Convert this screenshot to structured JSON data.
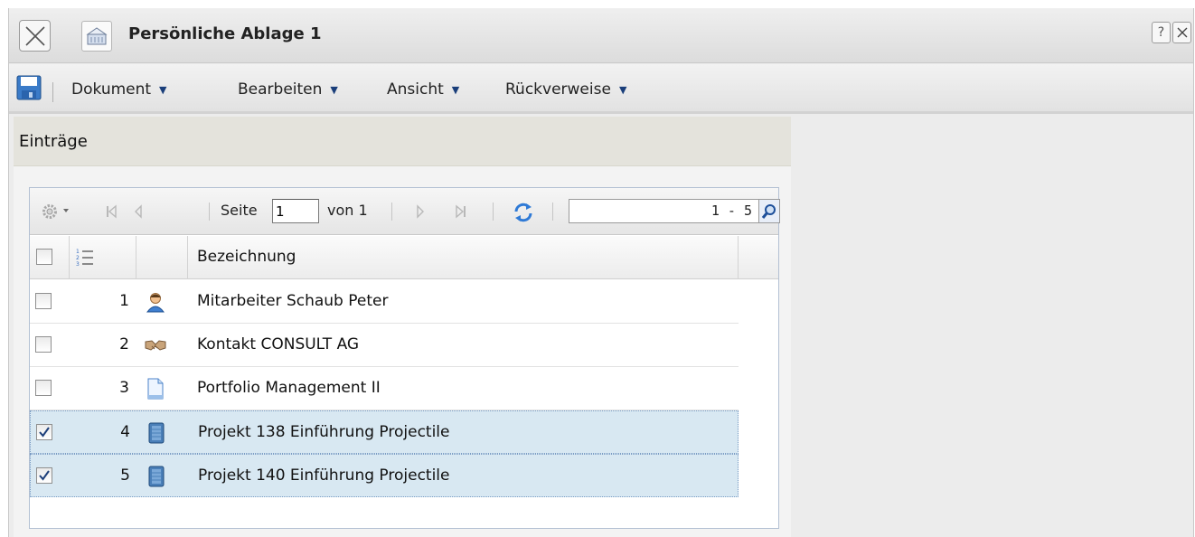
{
  "window": {
    "title": "Persönliche Ablage 1",
    "help_label": "?"
  },
  "menu": {
    "items": [
      {
        "label": "Dokument"
      },
      {
        "label": "Bearbeiten"
      },
      {
        "label": "Ansicht"
      },
      {
        "label": "Rückverweise"
      }
    ],
    "caret": "▼"
  },
  "panel": {
    "title": "Einträge"
  },
  "pager": {
    "page_label": "Seite",
    "page_value": "1",
    "of_label": "von 1",
    "range": "1 - 5"
  },
  "table": {
    "column_header": "Bezeichnung",
    "rows": [
      {
        "num": "1",
        "label": "Mitarbeiter Schaub Peter",
        "checked": false,
        "icon": "person-icon"
      },
      {
        "num": "2",
        "label": "Kontakt CONSULT AG",
        "checked": false,
        "icon": "handshake-icon"
      },
      {
        "num": "3",
        "label": "Portfolio Management II",
        "checked": false,
        "icon": "document-icon"
      },
      {
        "num": "4",
        "label": "Projekt 138 Einführung Projectile",
        "checked": true,
        "icon": "project-icon"
      },
      {
        "num": "5",
        "label": "Projekt 140 Einführung Projectile",
        "checked": true,
        "icon": "project-icon"
      }
    ]
  },
  "colors": {
    "selected_row": "#d8e8f2",
    "panel_header": "#e4e3dc",
    "accent": "#1a3e7a"
  }
}
